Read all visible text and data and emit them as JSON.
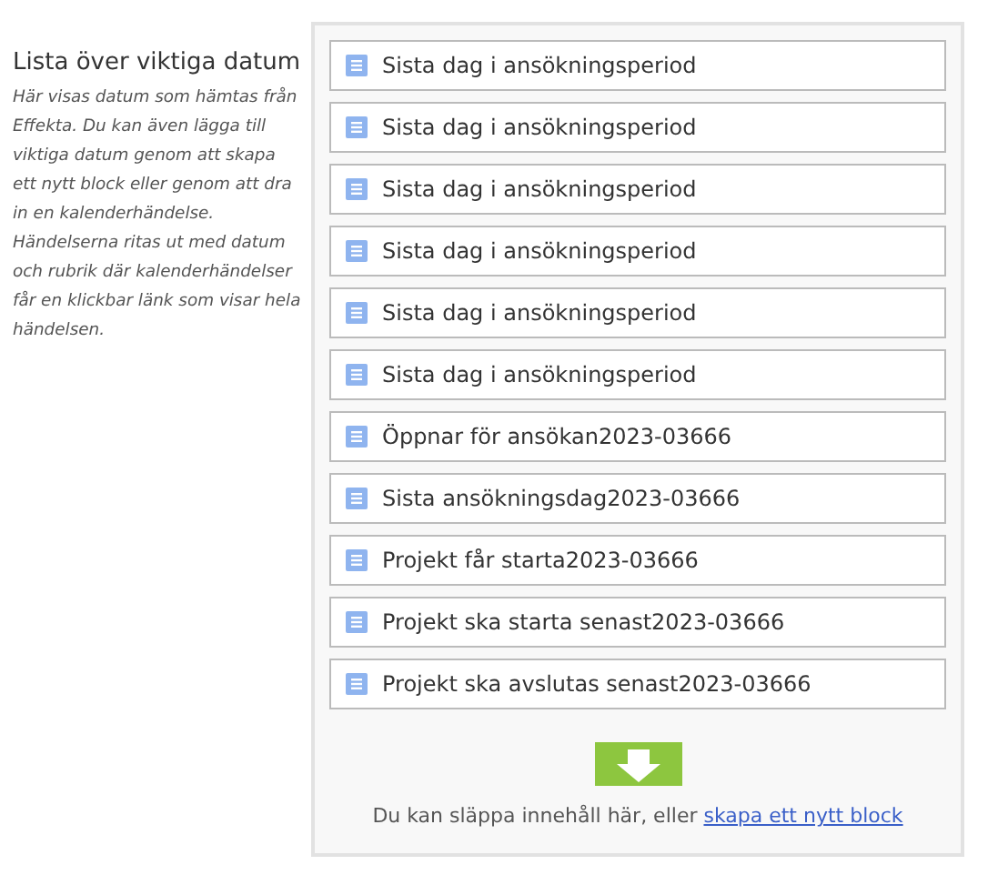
{
  "sidebar": {
    "title": "Lista över viktiga datum",
    "description": "Här visas datum som hämtas från Effekta. Du kan även lägga till viktiga datum genom att skapa ett nytt block eller genom att dra in en kalenderhändelse. Händelserna ritas ut med datum och rubrik där kalenderhändelser får en klickbar länk som visar hela händelsen."
  },
  "blocks": [
    {
      "label": "Sista dag i ansökningsperiod"
    },
    {
      "label": "Sista dag i ansökningsperiod"
    },
    {
      "label": "Sista dag i ansökningsperiod"
    },
    {
      "label": "Sista dag i ansökningsperiod"
    },
    {
      "label": "Sista dag i ansökningsperiod"
    },
    {
      "label": "Sista dag i ansökningsperiod"
    },
    {
      "label": "Öppnar för ansökan2023-03666"
    },
    {
      "label": "Sista ansökningsdag2023-03666"
    },
    {
      "label": "Projekt får starta2023-03666"
    },
    {
      "label": "Projekt ska starta senast2023-03666"
    },
    {
      "label": "Projekt ska avslutas senast2023-03666"
    }
  ],
  "drop_zone": {
    "hint": "Du kan släppa innehåll här, eller",
    "link": "skapa ett nytt block"
  }
}
